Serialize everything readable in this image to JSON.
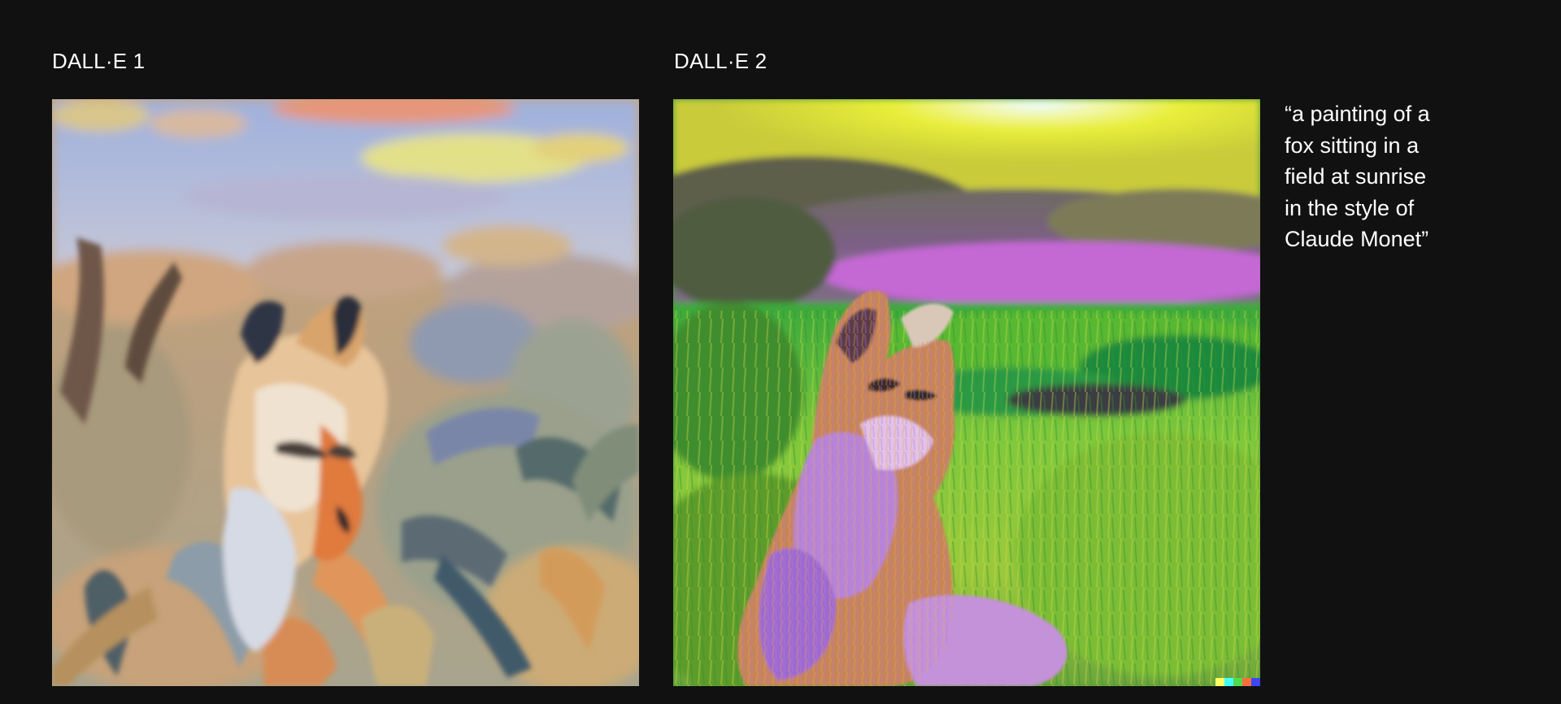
{
  "panels": [
    {
      "label": "DALL·E 1",
      "image_icon": "fox-painting-dalle1"
    },
    {
      "label": "DALL·E 2",
      "image_icon": "fox-painting-dalle2",
      "watermark_colors": [
        "#ffff66",
        "#42ffff",
        "#51da4c",
        "#ff6e3c",
        "#3c46ff"
      ]
    }
  ],
  "caption": "“a painting of a\n fox sitting in a\n field at sunrise\n in the style of\n Claude Monet”",
  "colors": {
    "background": "#111111",
    "text": "#ffffff"
  }
}
